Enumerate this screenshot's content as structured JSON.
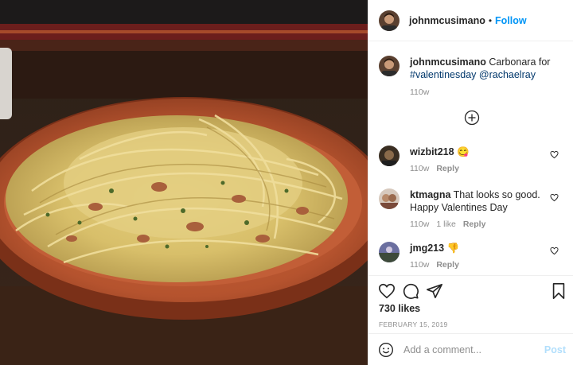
{
  "post": {
    "author": "johnmcusimano",
    "follow_label": "Follow",
    "separator": "•",
    "caption": {
      "username": "johnmcusimano",
      "text": "Carbonara for",
      "hashtag": "#valentinesday",
      "mention": "@rachaelray",
      "time": "110w"
    },
    "comments": [
      {
        "username": "wizbit218",
        "text": "😋",
        "time": "110w",
        "likes": "",
        "reply_label": "Reply"
      },
      {
        "username": "ktmagna",
        "text": "That looks so good. Happy Valentines Day",
        "time": "110w",
        "likes": "1 like",
        "reply_label": "Reply"
      },
      {
        "username": "jmg213",
        "text": "👎",
        "time": "110w",
        "likes": "",
        "reply_label": "Reply"
      }
    ],
    "likes_count": "730 likes",
    "date": "FEBRUARY 15, 2019",
    "add_comment_placeholder": "Add a comment...",
    "post_button_label": "Post"
  },
  "colors": {
    "accent": "#0095f6",
    "link": "#00376b",
    "muted": "#8e8e8e",
    "post_disabled": "#b2dffc"
  },
  "icons": {
    "load_more": "plus-circle-icon",
    "like": "heart-icon",
    "comment": "comment-bubble-icon",
    "share": "paper-plane-icon",
    "save": "bookmark-icon",
    "emoji": "smiley-icon"
  }
}
